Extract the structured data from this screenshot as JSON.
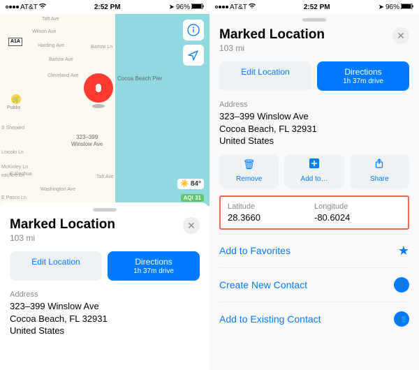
{
  "status": {
    "carrier": "AT&T",
    "wifi_icon": "wifi",
    "time": "2:52 PM",
    "battery": "96%",
    "loc_icon": "loc"
  },
  "map": {
    "pier_label": "Cocoa Beach Pier",
    "pin_addr": "323–399\nWinslow Ave",
    "weather": "84°",
    "aqi": "AQI 31",
    "route_badge": "A1A",
    "publix_label": "Publix",
    "roads": [
      "Taft Ave",
      "Wilson Ave",
      "Harding Ave",
      "Barlow Ave",
      "S Shepard",
      "Lincoln Ln",
      "McKinley Ln",
      "Washington Ave",
      "E Pasco Ln",
      "E Alachua",
      "eachee Ln",
      "Cleveland Ave",
      "Taft Ave",
      "Barlow Ln"
    ]
  },
  "sheet": {
    "title": "Marked Location",
    "distance": "103 mi",
    "edit": "Edit Location",
    "directions": "Directions",
    "drive": "1h 37m drive",
    "address_label": "Address",
    "address_line1": "323–399 Winslow Ave",
    "address_line2": "Cocoa Beach, FL  32931",
    "address_line3": "United States",
    "remove": "Remove",
    "addto": "Add to…",
    "share": "Share",
    "lat_label": "Latitude",
    "lat": "28.3660",
    "lon_label": "Longitude",
    "lon": "-80.6024",
    "fav": "Add to Favorites",
    "new_contact": "Create New Contact",
    "existing_contact": "Add to Existing Contact"
  }
}
